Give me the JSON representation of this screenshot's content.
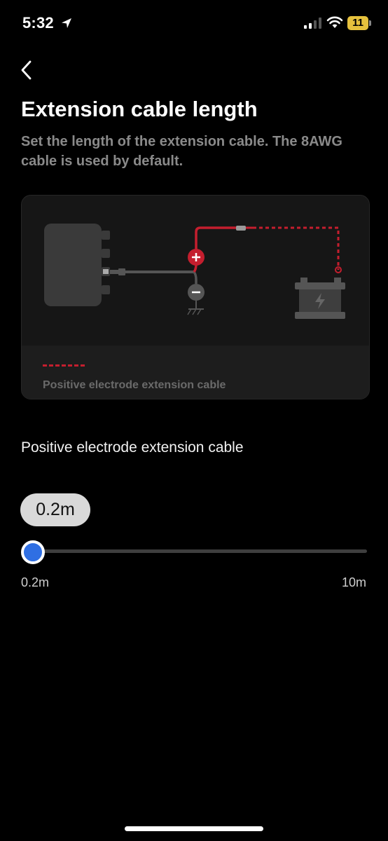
{
  "status_bar": {
    "time": "5:32",
    "battery": "11",
    "icons": [
      "location-arrow-icon",
      "cellular-signal-icon",
      "wifi-icon",
      "battery-charging-icon"
    ]
  },
  "header": {
    "back_icon": "chevron-left-icon",
    "title": "Extension cable length",
    "subtitle": "Set the length of the extension cable. The 8AWG cable is used by default."
  },
  "diagram": {
    "legend_label": "Positive electrode extension cable",
    "colors": {
      "positive": "#c41e2e",
      "negative": "#555555",
      "device": "#3a3a3a"
    },
    "icons": [
      "device-icon",
      "plus-terminal-icon",
      "minus-terminal-icon",
      "ground-icon",
      "battery-icon",
      "lightning-icon"
    ]
  },
  "setting": {
    "label": "Positive electrode extension cable",
    "value_display": "0.2m",
    "slider": {
      "min_label": "0.2m",
      "max_label": "10m",
      "value": 0.2,
      "min": 0.2,
      "max": 10,
      "accent": "#2f6fe3"
    }
  }
}
